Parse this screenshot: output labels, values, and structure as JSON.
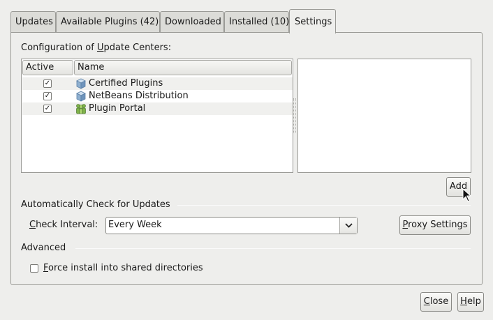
{
  "tabs": [
    {
      "label": "Updates"
    },
    {
      "label": "Available Plugins (42)"
    },
    {
      "label": "Downloaded"
    },
    {
      "label": "Installed (10)"
    },
    {
      "label": "Settings",
      "active": true
    }
  ],
  "config": {
    "label_pre": "Configuration of ",
    "label_ul": "U",
    "label_post": "pdate Centers:",
    "columns": [
      "Active",
      "Name"
    ],
    "rows": [
      {
        "active": true,
        "name": "Certified Plugins",
        "icon": "cube-icon"
      },
      {
        "active": true,
        "name": "NetBeans Distribution",
        "icon": "cube-icon"
      },
      {
        "active": true,
        "name": "Plugin Portal",
        "icon": "people-icon"
      }
    ],
    "add_label": "Add"
  },
  "auto_check": {
    "section_label": "Automatically Check for Updates",
    "interval_label_ul": "C",
    "interval_label_rest": "heck Interval:",
    "interval_value": "Every Week",
    "proxy_ul": "P",
    "proxy_rest": "roxy Settings"
  },
  "advanced": {
    "section_label": "Advanced",
    "force_ul": "F",
    "force_rest": "orce install into shared directories",
    "force_checked": false
  },
  "footer": {
    "close_ul": "C",
    "close_rest": "lose",
    "help_ul": "H",
    "help_rest": "elp"
  },
  "check_glyph": "✓",
  "colors": {
    "background": "#eeeeec",
    "border": "#9a9a96"
  }
}
